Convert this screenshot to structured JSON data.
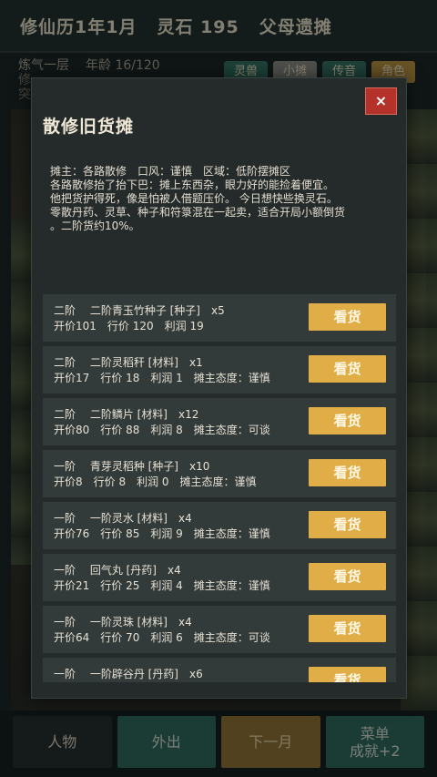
{
  "topbar": {
    "calendar": "修仙历1年1月",
    "spirit_stones": "灵石 195",
    "legacy": "父母遗摊"
  },
  "status": {
    "realm": "炼气一层",
    "age": "年龄 16/120",
    "line2": "修",
    "line3": "突"
  },
  "tabs": [
    {
      "label": "灵兽"
    },
    {
      "label": "小摊"
    },
    {
      "label": "传音"
    },
    {
      "label": "角色"
    }
  ],
  "bottom_nav": {
    "character": "人物",
    "go_out": "外出",
    "next_month": "下一月",
    "menu": "菜单",
    "achievement": "成就+2"
  },
  "modal": {
    "title": "散修旧货摊",
    "close_label": "×",
    "description": [
      "摊主：各路散修　口风：谨慎　区域：低阶摆摊区",
      "各路散修抬了抬下巴：摊上东西杂，眼力好的能捡着便宜。",
      "他把货护得死，像是怕被人借题压价。 今日想快些换灵石。",
      "零散丹药、灵草、种子和符箓混在一起卖，适合开局小额倒货",
      "。二阶货约10%。"
    ],
    "buy_label": "看货",
    "items": [
      {
        "line1": "二阶　 二阶青玉竹种子 [种子]　x5",
        "line2": "开价101　行价 120　利润 19"
      },
      {
        "line1": "二阶　 二阶灵稻秆 [材料]　x1",
        "line2": "开价17　行价 18　利润 1　摊主态度：谨慎"
      },
      {
        "line1": "二阶　 二阶鳞片 [材料]　x12",
        "line2": "开价80　行价 88　利润 8　摊主态度：可谈"
      },
      {
        "line1": "一阶　 青芽灵稻种 [种子]　x10",
        "line2": "开价8　行价 8　利润 0　摊主态度：谨慎"
      },
      {
        "line1": "一阶　 一阶灵水 [材料]　x4",
        "line2": "开价76　行价 85　利润 9　摊主态度：谨慎"
      },
      {
        "line1": "一阶　 回气丸 [丹药]　x4",
        "line2": "开价21　行价 25　利润 4　摊主态度：谨慎"
      },
      {
        "line1": "一阶　 一阶灵珠 [材料]　x4",
        "line2": "开价64　行价 70　利润 6　摊主态度：可谈"
      },
      {
        "line1": "一阶　 一阶辟谷丹 [丹药]　x6",
        "line2": ""
      }
    ]
  }
}
